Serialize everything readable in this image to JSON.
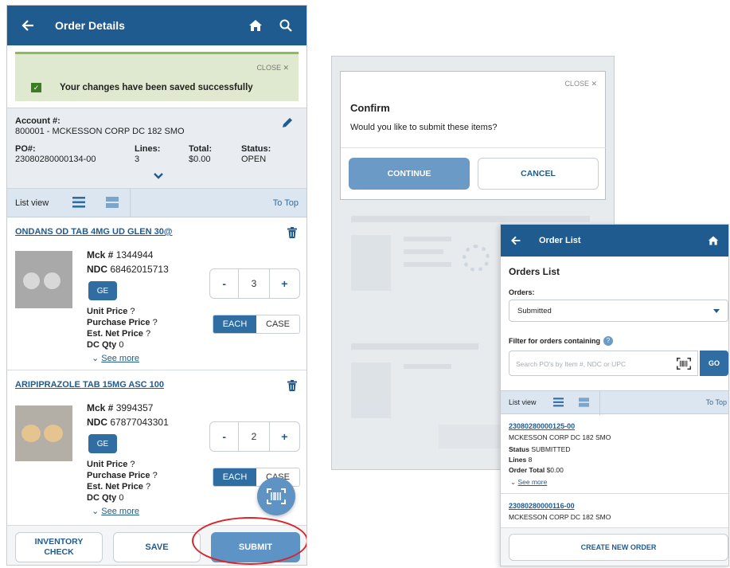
{
  "order_details": {
    "title": "Order Details",
    "alert": {
      "close": "CLOSE",
      "message": "Your changes have been saved successfully"
    },
    "account": {
      "label": "Account #:",
      "value": "800001 - MCKESSON CORP DC 182 SMO",
      "po_label": "PO#:",
      "po_value": "23080280000134-00",
      "lines_label": "Lines:",
      "lines_value": "3",
      "total_label": "Total:",
      "total_value": "$0.00",
      "status_label": "Status:",
      "status_value": "OPEN"
    },
    "listview": {
      "label": "List view",
      "to_top": "To Top"
    },
    "items": [
      {
        "name": "ONDANS OD TAB 4MG UD GLEN 30@",
        "mck_label": "Mck #",
        "mck": "1344944",
        "ndc_label": "NDC",
        "ndc": "68462015713",
        "ge": "GE",
        "qty": "3",
        "minus": "-",
        "plus": "+",
        "unit_price": "Unit Price",
        "purchase_price": "Purchase Price",
        "est_net_price": "Est. Net Price",
        "unknown": "?",
        "dc_qty_label": "DC Qty",
        "dc_qty": "0",
        "each": "EACH",
        "case": "CASE",
        "see_more": "See more",
        "pill_color": "#d8d8d8"
      },
      {
        "name": "ARIPIPRAZOLE TAB 15MG ASC 100",
        "mck_label": "Mck #",
        "mck": "3994357",
        "ndc_label": "NDC",
        "ndc": "67877043301",
        "ge": "GE",
        "qty": "2",
        "minus": "-",
        "plus": "+",
        "unit_price": "Unit Price",
        "purchase_price": "Purchase Price",
        "est_net_price": "Est. Net Price",
        "unknown": "?",
        "dc_qty_label": "DC Qty",
        "dc_qty": "0",
        "each": "EACH",
        "case": "CASE",
        "see_more": "See more",
        "pill_color": "#e5c48f"
      }
    ],
    "footer": {
      "inventory_check": "INVENTORY CHECK",
      "save": "SAVE",
      "submit": "SUBMIT"
    }
  },
  "confirm": {
    "close": "CLOSE",
    "title": "Confirm",
    "message": "Would you like to submit these items?",
    "continue": "CONTINUE",
    "cancel": "CANCEL"
  },
  "order_list": {
    "title": "Order List",
    "heading": "Orders List",
    "orders_label": "Orders:",
    "orders_selected": "Submitted",
    "filter_label": "Filter for orders containing",
    "search_placeholder": "Search PO's by Item #, NDC or UPC",
    "go": "GO",
    "listview": "List view",
    "to_top": "To Top",
    "orders": [
      {
        "po": "23080280000125-00",
        "account": "MCKESSON CORP DC 182 SMO",
        "status_label": "Status",
        "status": "SUBMITTED",
        "lines_label": "Lines",
        "lines": "8",
        "total_label": "Order Total",
        "total": "$0.00",
        "see_more": "See more"
      },
      {
        "po": "23080280000116-00",
        "account": "MCKESSON CORP DC 182 SMO"
      }
    ],
    "create": "CREATE NEW ORDER"
  },
  "colors": {
    "brand": "#1f5b8f",
    "success_bg": "#dfe9cf",
    "success_border": "#8dbb5a",
    "highlight": "#d6262b"
  }
}
